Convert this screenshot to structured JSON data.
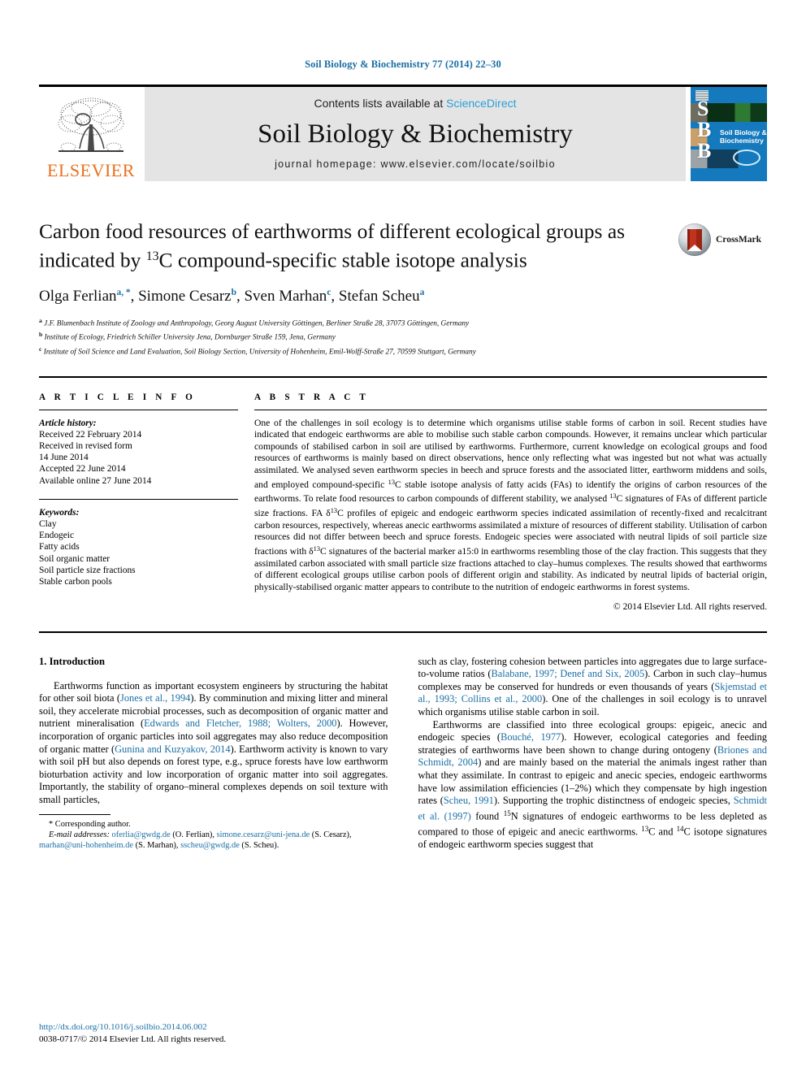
{
  "running_head": "Soil Biology & Biochemistry 77 (2014) 22–30",
  "masthead": {
    "publisher_name": "ELSEVIER",
    "contents_prefix": "Contents lists available at ",
    "sciencedirect": "ScienceDirect",
    "journal_title": "Soil Biology & Biochemistry",
    "homepage": "journal homepage: www.elsevier.com/locate/soilbio",
    "cover": {
      "letters": "S\nB\nB",
      "title_line1": "Soil Biology &",
      "title_line2": "Biochemistry"
    }
  },
  "article": {
    "title_part1": "Carbon food resources of earthworms of different ecological groups as indicated by ",
    "title_sup": "13",
    "title_part2": "C compound-specific stable isotope analysis",
    "crossmark_label": "CrossMark",
    "authors": [
      {
        "name": "Olga Ferlian",
        "sup": "a, *"
      },
      {
        "name": "Simone Cesarz",
        "sup": "b"
      },
      {
        "name": "Sven Marhan",
        "sup": "c"
      },
      {
        "name": "Stefan Scheu",
        "sup": "a"
      }
    ],
    "affiliations": [
      {
        "mark": "a",
        "text": "J.F. Blumenbach Institute of Zoology and Anthropology, Georg August University Göttingen, Berliner Straße 28, 37073 Göttingen, Germany"
      },
      {
        "mark": "b",
        "text": "Institute of Ecology, Friedrich Schiller University Jena, Dornburger Straße 159, Jena, Germany"
      },
      {
        "mark": "c",
        "text": "Institute of Soil Science and Land Evaluation, Soil Biology Section, University of Hohenheim, Emil-Wolff-Straße 27, 70599 Stuttgart, Germany"
      }
    ]
  },
  "article_info": {
    "heading": "A R T I C L E  I N F O",
    "history_label": "Article history:",
    "history": [
      "Received 22 February 2014",
      "Received in revised form",
      "14 June 2014",
      "Accepted 22 June 2014",
      "Available online 27 June 2014"
    ],
    "keywords_label": "Keywords:",
    "keywords": [
      "Clay",
      "Endogeic",
      "Fatty acids",
      "Soil organic matter",
      "Soil particle size fractions",
      "Stable carbon pools"
    ]
  },
  "abstract": {
    "heading": "A B S T R A C T",
    "p1": "One of the challenges in soil ecology is to determine which organisms utilise stable forms of carbon in soil. Recent studies have indicated that endogeic earthworms are able to mobilise such stable carbon compounds. However, it remains unclear which particular compounds of stabilised carbon in soil are utilised by earthworms. Furthermore, current knowledge on ecological groups and food resources of earthworms is mainly based on direct observations, hence only reflecting what was ingested but not what was actually assimilated. We analysed seven earthworm species in beech and spruce forests and the associated litter, earthworm middens and soils, and employed compound-specific ",
    "sup1": "13",
    "p2": "C stable isotope analysis of fatty acids (FAs) to identify the origins of carbon resources of the earthworms. To relate food resources to carbon compounds of different stability, we analysed ",
    "sup2": "13",
    "p3": "C signatures of FAs of different particle size fractions. FA δ",
    "sup3": "13",
    "p4": "C profiles of epigeic and endogeic earthworm species indicated assimilation of recently-fixed and recalcitrant carbon resources, respectively, whereas anecic earthworms assimilated a mixture of resources of different stability. Utilisation of carbon resources did not differ between beech and spruce forests. Endogeic species were associated with neutral lipids of soil particle size fractions with δ",
    "sup4": "13",
    "p5": "C signatures of the bacterial marker a15:0 in earthworms resembling those of the clay fraction. This suggests that they assimilated carbon associated with small particle size fractions attached to clay–humus complexes. The results showed that earthworms of different ecological groups utilise carbon pools of different origin and stability. As indicated by neutral lipids of bacterial origin, physically-stabilised organic matter appears to contribute to the nutrition of endogeic earthworms in forest systems.",
    "copyright": "© 2014 Elsevier Ltd. All rights reserved."
  },
  "introduction": {
    "heading": "1. Introduction",
    "left_p1_a": "Earthworms function as important ecosystem engineers by structuring the habitat for other soil biota (",
    "left_ref1": "Jones et al., 1994",
    "left_p1_b": "). By comminution and mixing litter and mineral soil, they accelerate microbial processes, such as decomposition of organic matter and nutrient mineralisation (",
    "left_ref2": "Edwards and Fletcher, 1988; Wolters, 2000",
    "left_p1_c": "). However, incorporation of organic particles into soil aggregates may also reduce decomposition of organic matter (",
    "left_ref3": "Gunina and Kuzyakov, 2014",
    "left_p1_d": "). Earthworm activity is known to vary with soil pH but also depends on forest type, e.g., spruce forests have low earthworm bioturbation activity and low incorporation of organic matter into soil aggregates. Importantly, the stability of organo–mineral complexes depends on soil texture with small particles,",
    "right_p1_a": "such as clay, fostering cohesion between particles into aggregates due to large surface-to-volume ratios (",
    "right_ref1": "Balabane, 1997; Denef and Six, 2005",
    "right_p1_b": "). Carbon in such clay–humus complexes may be conserved for hundreds or even thousands of years (",
    "right_ref2": "Skjemstad et al., 1993; Collins et al., 2000",
    "right_p1_c": "). One of the challenges in soil ecology is to unravel which organisms utilise stable carbon in soil.",
    "right_p2_a": "Earthworms are classified into three ecological groups: epigeic, anecic and endogeic species (",
    "right_ref3": "Bouché, 1977",
    "right_p2_b": "). However, ecological categories and feeding strategies of earthworms have been shown to change during ontogeny (",
    "right_ref4": "Briones and Schmidt, 2004",
    "right_p2_c": ") and are mainly based on the material the animals ingest rather than what they assimilate. In contrast to epigeic and anecic species, endogeic earthworms have low assimilation efficiencies (1–2%) which they compensate by high ingestion rates (",
    "right_ref5": "Scheu, 1991",
    "right_p2_d": "). Supporting the trophic distinctness of endogeic species, ",
    "right_ref6": "Schmidt et al. (1997)",
    "right_p2_e": " found ",
    "right_sup1": "15",
    "right_p2_f": "N signatures of endogeic earthworms to be less depleted as compared to those of epigeic and anecic earthworms. ",
    "right_sup2": "13",
    "right_p2_g": "C and ",
    "right_sup3": "14",
    "right_p2_h": "C isotope signatures of endogeic earthworm species suggest that"
  },
  "footnote": {
    "corresponding": "* Corresponding author.",
    "email_label": "E-mail addresses:",
    "emails": [
      {
        "addr": "oferlia@gwdg.de",
        "who": " (O. Ferlian), "
      },
      {
        "addr": "simone.cesarz@uni-jena.de",
        "who": " (S. Cesarz), "
      },
      {
        "addr": "marhan@uni-hohenheim.de",
        "who": " (S. Marhan), "
      },
      {
        "addr": "sscheu@gwdg.de",
        "who": " (S. Scheu)."
      }
    ]
  },
  "page_footer": {
    "doi": "http://dx.doi.org/10.1016/j.soilbio.2014.06.002",
    "issn_line": "0038-0717/© 2014 Elsevier Ltd. All rights reserved."
  },
  "colors": {
    "link_blue": "#1a6fa5",
    "sciencedirect_blue": "#2a9fd6",
    "elsevier_orange": "#E9711C",
    "cover_blue": "#1479bd"
  }
}
